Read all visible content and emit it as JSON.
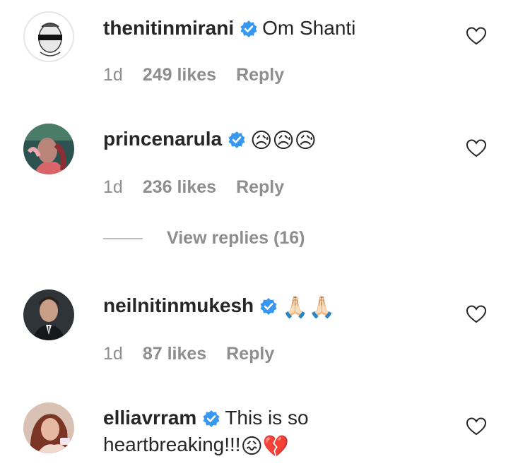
{
  "comments": [
    {
      "username": "thenitinmirani",
      "text": "Om Shanti",
      "emojis": "",
      "time": "1d",
      "likes": "249 likes",
      "reply_label": "Reply",
      "verified": true
    },
    {
      "username": "princenarula",
      "text": "",
      "emojis": "😥😥😥",
      "time": "1d",
      "likes": "236 likes",
      "reply_label": "Reply",
      "verified": true
    },
    {
      "username": "neilnitinmukesh",
      "text": "",
      "emojis": "🙏🏻🙏🏻",
      "time": "1d",
      "likes": "87 likes",
      "reply_label": "Reply",
      "verified": true
    },
    {
      "username": "elliavrram",
      "text": "This is so heartbreaking!!!",
      "emojis": "😖💔",
      "verified": true
    }
  ],
  "view_replies": "View replies (16)",
  "colors": {
    "text": "#262626",
    "meta": "#8e8e8e",
    "verified": "#3897f0"
  },
  "icons": {
    "verified": "verified-badge-icon",
    "like": "heart-outline-icon"
  }
}
